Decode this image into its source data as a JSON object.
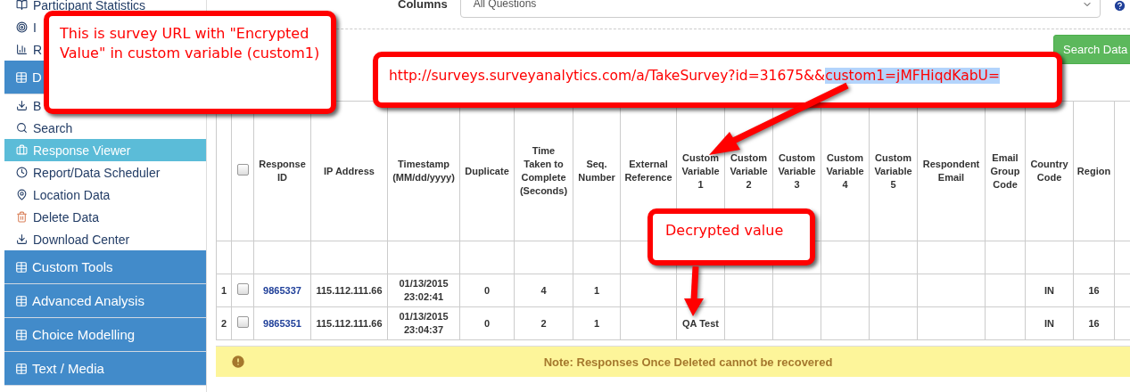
{
  "sidebar": {
    "items": [
      {
        "kind": "link",
        "label": "Participant Statistics",
        "selected": false
      },
      {
        "kind": "link",
        "label": "I",
        "selected": false
      },
      {
        "kind": "link",
        "label": "R",
        "selected": false
      },
      {
        "kind": "section",
        "label": "D"
      },
      {
        "kind": "link",
        "label": "B",
        "selected": false
      },
      {
        "kind": "link",
        "label": "Search",
        "selected": false
      },
      {
        "kind": "link",
        "label": "Response Viewer",
        "selected": true
      },
      {
        "kind": "link",
        "label": "Report/Data Scheduler",
        "selected": false
      },
      {
        "kind": "link",
        "label": "Location Data",
        "selected": false
      },
      {
        "kind": "link",
        "label": "Delete Data",
        "selected": false
      },
      {
        "kind": "link",
        "label": "Download Center",
        "selected": false
      },
      {
        "kind": "section",
        "label": "Custom Tools"
      },
      {
        "kind": "section",
        "label": "Advanced Analysis"
      },
      {
        "kind": "section",
        "label": "Choice Modelling"
      },
      {
        "kind": "section",
        "label": "Text / Media"
      }
    ]
  },
  "filters": {
    "columns_label": "Columns",
    "columns_value": "All Questions"
  },
  "search_button": "Search Data",
  "table": {
    "columns": [
      {
        "kind": "number"
      },
      {
        "kind": "select",
        "checked": false
      },
      {
        "kind": "link",
        "label": "Response ID"
      },
      {
        "kind": "text",
        "label": "IP Address"
      },
      {
        "kind": "text",
        "label": "Timestamp (MM/dd/yyyy)"
      },
      {
        "kind": "text",
        "label": "Duplicate"
      },
      {
        "kind": "text",
        "label": "Time Taken to Complete (Seconds)"
      },
      {
        "kind": "text",
        "label": "Seq. Number"
      },
      {
        "kind": "text",
        "label": "External Reference"
      },
      {
        "kind": "text",
        "label": "Custom Variable 1"
      },
      {
        "kind": "text",
        "label": "Custom Variable 2"
      },
      {
        "kind": "text",
        "label": "Custom Variable 3"
      },
      {
        "kind": "text",
        "label": "Custom Variable 4"
      },
      {
        "kind": "text",
        "label": "Custom Variable 5"
      },
      {
        "kind": "text",
        "label": "Respondent Email"
      },
      {
        "kind": "text",
        "label": "Email Group Code"
      },
      {
        "kind": "text",
        "label": "Country Code"
      },
      {
        "kind": "text",
        "label": "Region"
      },
      {
        "kind": "text"
      }
    ],
    "rows": [
      {
        "checked": false,
        "cells": [
          "1",
          "",
          "9865337",
          "115.112.111.66",
          "01/13/2015 23:02:41",
          "0",
          "4",
          "1",
          "",
          "",
          "",
          "",
          "",
          "",
          "",
          "",
          "IN",
          "16",
          ""
        ]
      },
      {
        "checked": false,
        "cells": [
          "2",
          "",
          "9865351",
          "115.112.111.66",
          "01/13/2015 23:04:37",
          "0",
          "2",
          "1",
          "",
          "QA Test",
          "",
          "",
          "",
          "",
          "",
          "",
          "IN",
          "16",
          ""
        ]
      }
    ]
  },
  "note": "Note: Responses Once Deleted cannot be recovered",
  "annotations": {
    "encrypted_callout": "This is survey URL with \"Encrypted Value\" in custom variable (custom1)",
    "url_segments": [
      {
        "text": "http://surveys.surveyanalytics.com/a/TakeSurvey?id=31675&&",
        "selected": false
      },
      {
        "text": "custom1=jMFHiqdKabU=",
        "selected": true
      }
    ],
    "decrypted_callout": "Decrypted value"
  }
}
